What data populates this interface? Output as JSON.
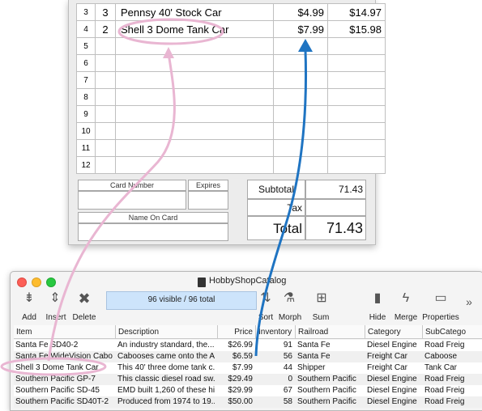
{
  "invoice": {
    "rows": [
      {
        "num": "3",
        "qty": "3",
        "desc": "Pennsy 40' Stock Car",
        "price": "$4.99",
        "total": "$14.97"
      },
      {
        "num": "4",
        "qty": "2",
        "desc": "Shell 3 Dome Tank Car",
        "price": "$7.99",
        "total": "$15.98"
      },
      {
        "num": "5",
        "qty": "",
        "desc": "",
        "price": "",
        "total": ""
      },
      {
        "num": "6",
        "qty": "",
        "desc": "",
        "price": "",
        "total": ""
      },
      {
        "num": "7",
        "qty": "",
        "desc": "",
        "price": "",
        "total": ""
      },
      {
        "num": "8",
        "qty": "",
        "desc": "",
        "price": "",
        "total": ""
      },
      {
        "num": "9",
        "qty": "",
        "desc": "",
        "price": "",
        "total": ""
      },
      {
        "num": "10",
        "qty": "",
        "desc": "",
        "price": "",
        "total": ""
      },
      {
        "num": "11",
        "qty": "",
        "desc": "",
        "price": "",
        "total": ""
      },
      {
        "num": "12",
        "qty": "",
        "desc": "",
        "price": "",
        "total": ""
      }
    ],
    "card_number_label": "Card Number",
    "expires_label": "Expires",
    "name_on_card_label": "Name On Card",
    "subtotal_label": "Subtotal",
    "subtotal_value": "71.43",
    "tax_label": "Tax",
    "tax_value": "",
    "total_label": "Total",
    "total_value": "71.43"
  },
  "window": {
    "title": "HobbyShopCatalog",
    "status": "96 visible / 96 total",
    "toolbar": {
      "add": "Add",
      "insert": "Insert",
      "delete": "Delete",
      "sort": "Sort",
      "morph": "Morph",
      "sum": "Sum",
      "hide": "Hide",
      "merge": "Merge",
      "properties": "Properties",
      "more": "»"
    },
    "columns": [
      "Item",
      "Description",
      "Price",
      "Inventory",
      "Railroad",
      "Category",
      "SubCatego"
    ],
    "rows": [
      [
        "Santa Fe SD40-2",
        "An industry standard, the...",
        "$26.99",
        "91",
        "Santa Fe",
        "Diesel Engine",
        "Road Freig"
      ],
      [
        "Santa Fe WideVision Cabo...",
        "Cabooses came onto the A...",
        "$6.59",
        "56",
        "Santa Fe",
        "Freight Car",
        "Caboose"
      ],
      [
        "Shell 3 Dome Tank Car",
        "This 40' three dome tank c...",
        "$7.99",
        "44",
        "Shipper",
        "Freight Car",
        "Tank Car"
      ],
      [
        "Southern Pacific GP-7",
        "This classic diesel road sw...",
        "$29.49",
        "0",
        "Southern Pacific",
        "Diesel Engine",
        "Road Freig"
      ],
      [
        "Southern Pacific SD-45",
        "EMD built 1,260 of these hi...",
        "$29.99",
        "67",
        "Southern Pacific",
        "Diesel Engine",
        "Road Freig"
      ],
      [
        "Southern Pacific SD40T-2",
        "Produced from 1974 to 19...",
        "$50.00",
        "58",
        "Southern Pacific",
        "Diesel Engine",
        "Road Freig"
      ]
    ]
  },
  "colors": {
    "pink_annotation": "#e9b6d2",
    "blue_annotation": "#1f74c2",
    "status_field": "#cde4fb"
  }
}
